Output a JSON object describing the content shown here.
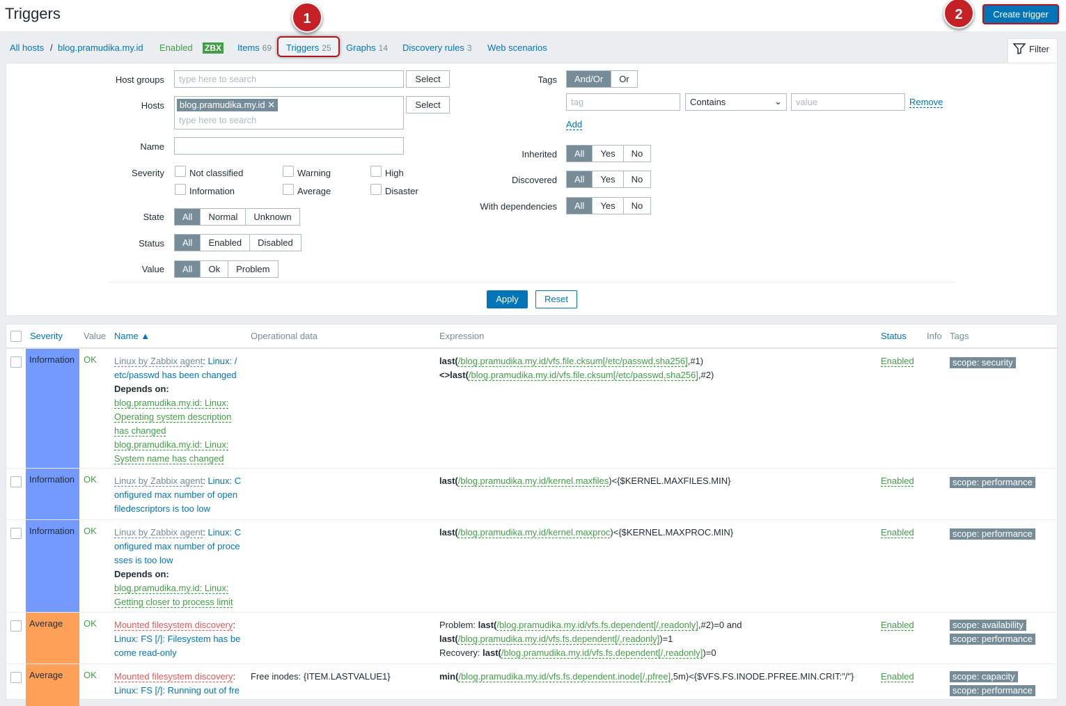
{
  "header": {
    "title": "Triggers",
    "create_label": "Create trigger",
    "step1": "1",
    "step2": "2"
  },
  "nav": {
    "all_hosts": "All hosts",
    "sep": "/",
    "host": "blog.pramudika.my.id",
    "enabled": "Enabled",
    "zbx": "ZBX",
    "items": "Items",
    "items_count": "69",
    "triggers": "Triggers",
    "triggers_count": "25",
    "graphs": "Graphs",
    "graphs_count": "14",
    "discovery": "Discovery rules",
    "discovery_count": "3",
    "web": "Web scenarios",
    "filter": "Filter"
  },
  "filter": {
    "host_groups_label": "Host groups",
    "hosts_label": "Hosts",
    "name_label": "Name",
    "severity_label": "Severity",
    "state_label": "State",
    "status_label": "Status",
    "value_label": "Value",
    "search_placeholder": "type here to search",
    "select": "Select",
    "host_chip": "blog.pramudika.my.id",
    "sev": {
      "not_classified": "Not classified",
      "warning": "Warning",
      "high": "High",
      "information": "Information",
      "average": "Average",
      "disaster": "Disaster"
    },
    "state": [
      "All",
      "Normal",
      "Unknown"
    ],
    "status": [
      "All",
      "Enabled",
      "Disabled"
    ],
    "value": [
      "All",
      "Ok",
      "Problem"
    ],
    "tags_label": "Tags",
    "tag_ops": [
      "And/Or",
      "Or"
    ],
    "tag_placeholder": "tag",
    "tag_op": "Contains",
    "value_placeholder": "value",
    "remove": "Remove",
    "add": "Add",
    "inherited_label": "Inherited",
    "discovered_label": "Discovered",
    "deps_label": "With dependencies",
    "ayn": [
      "All",
      "Yes",
      "No"
    ],
    "apply": "Apply",
    "reset": "Reset"
  },
  "table": {
    "headers": {
      "severity": "Severity",
      "value": "Value",
      "name": "Name ▲",
      "opdata": "Operational data",
      "expression": "Expression",
      "status": "Status",
      "info": "Info",
      "tags": "Tags"
    },
    "depends_on": "Depends on:",
    "rows": [
      {
        "severity": "Information",
        "value": "OK",
        "template": "Linux by Zabbix agent",
        "name1": "Linux: /",
        "name2": "etc/passwd has been changed",
        "deps": [
          "blog.pramudika.my.id: Linux:",
          "Operating system description",
          "has changed",
          "blog.pramudika.my.id: Linux:",
          "System name has changed"
        ],
        "expr1a": "last(",
        "expr1b": "/blog.pramudika.my.id/vfs.file.cksum[/etc/passwd,sha256]",
        "expr1c": ",#1)",
        "expr2a": "<>last(",
        "expr2b": "/blog.pramudika.my.id/vfs.file.cksum[/etc/passwd,sha256]",
        "expr2c": ",#2)",
        "status": "Enabled",
        "tags": [
          "scope: security"
        ]
      },
      {
        "severity": "Information",
        "value": "OK",
        "template": "Linux by Zabbix agent",
        "name1": "Linux: C",
        "name2": "onfigured max number of open",
        "name3": "filedescriptors is too low",
        "expr1a": "last(",
        "expr1b": "/blog.pramudika.my.id/kernel.maxfiles",
        "expr1c": ")<{$KERNEL.MAXFILES.MIN}",
        "status": "Enabled",
        "tags": [
          "scope: performance"
        ]
      },
      {
        "severity": "Information",
        "value": "OK",
        "template": "Linux by Zabbix agent",
        "name1": "Linux: C",
        "name2": "onfigured max number of proce",
        "name3": "sses is too low",
        "deps": [
          "blog.pramudika.my.id: Linux:",
          "Getting closer to process limit"
        ],
        "expr1a": "last(",
        "expr1b": "/blog.pramudika.my.id/kernel.maxproc",
        "expr1c": ")<{$KERNEL.MAXPROC.MIN}",
        "status": "Enabled",
        "tags": [
          "scope: performance"
        ]
      },
      {
        "severity": "Average",
        "value": "OK",
        "template": "Mounted filesystem discovery",
        "name1": "",
        "name2": "Linux: FS [/]: Filesystem has be",
        "name3": "come read-only",
        "expr_p": "Problem: ",
        "expr1a": "last(",
        "expr1b": "/blog.pramudika.my.id/vfs.fs.dependent[/,readonly]",
        "expr1c": ",#2)=0 and",
        "expr2a": "last(",
        "expr2b": "/blog.pramudika.my.id/vfs.fs.dependent[/,readonly]",
        "expr2c": ")=1",
        "expr_r": "Recovery: ",
        "expr3a": "last(",
        "expr3b": "/blog.pramudika.my.id/vfs.fs.dependent[/,readonly]",
        "expr3c": ")=0",
        "status": "Enabled",
        "tags": [
          "scope: availability",
          "scope: performance"
        ]
      },
      {
        "severity": "Average",
        "value": "OK",
        "template": "Mounted filesystem discovery",
        "name2": "Linux: FS [/]: Running out of fre",
        "opdata": "Free inodes: {ITEM.LASTVALUE1}",
        "expr1a": "min(",
        "expr1b": "/blog.pramudika.my.id/vfs.fs.dependent.inode[/,pfree]",
        "expr1c": ",5m)<{$VFS.FS.INODE.PFREE.MIN.CRIT:\"/\"}",
        "status": "Enabled",
        "tags": [
          "scope: capacity",
          "scope: performance"
        ]
      }
    ]
  },
  "colors": {
    "information": "#7499ff",
    "average": "#ffa059",
    "link": "#0275b8",
    "ok": "#429e47",
    "accent": "#b3151c"
  }
}
